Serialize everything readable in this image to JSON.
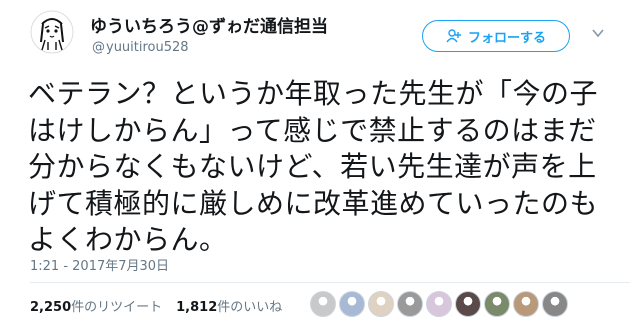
{
  "author": {
    "display_name": "ゆういちろう@ずゎだ通信担当",
    "handle_at": "@",
    "handle": "yuuitirou528",
    "avatar_icon": "avatar-drawing-icon"
  },
  "follow_button": {
    "label": "フォローする",
    "icon": "add-person-icon",
    "color": "#1da1f2"
  },
  "menu": {
    "icon": "chevron-down-icon"
  },
  "tweet": {
    "lines": [
      "ベテラン？というか年取った先生が「今の子",
      "はけしからん」って感じで禁止するのはまだ",
      "分からなくもないけど、若い先生達が声を上",
      "げて積極的に厳しめに改革進めていったのも",
      "よくわからん。"
    ],
    "timestamp": "1:21 - 2017年7月30日"
  },
  "stats": {
    "retweets_count": "2,250",
    "retweets_label": "件のリツイート",
    "likes_count": "1,812",
    "likes_label": "件のいいね"
  },
  "likers": [
    {
      "color": "#c9c9c9"
    },
    {
      "color": "#a8b9d6"
    },
    {
      "color": "#e0d2c2"
    },
    {
      "color": "#9a9a9a"
    },
    {
      "color": "#d8c6dc"
    },
    {
      "color": "#5a4a4a"
    },
    {
      "color": "#7a8a6a"
    },
    {
      "color": "#b89a7a"
    },
    {
      "color": "#888888"
    }
  ]
}
